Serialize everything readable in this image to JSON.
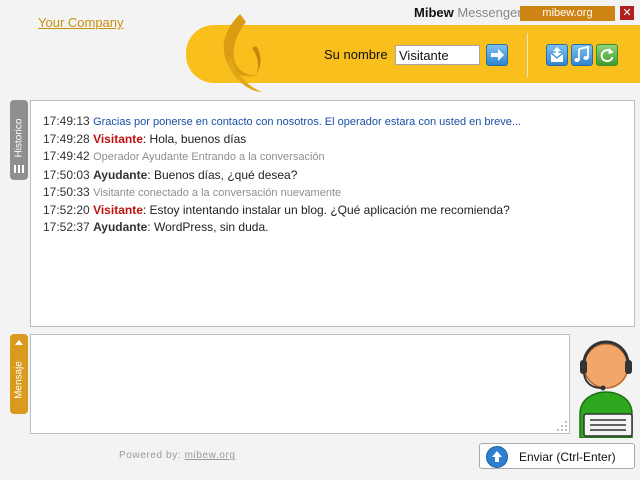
{
  "header": {
    "company_link": "Your Company",
    "brand_bold": "Mibew",
    "brand_light": "Messenger",
    "site_badge": "mibew.org",
    "name_label": "Su nombre",
    "name_value": "Visitante"
  },
  "side_tabs": {
    "history": "Historico",
    "message": "Mensaje"
  },
  "chat": {
    "messages": [
      {
        "time": "17:49:13",
        "kind": "info",
        "text": "Gracias por ponerse en contacto con nosotros. El operador estara con usted en breve..."
      },
      {
        "time": "17:49:28",
        "kind": "visitor",
        "who": "Visitante",
        "text": ": Hola, buenos días"
      },
      {
        "time": "17:49:42",
        "kind": "system",
        "text": "Operador Ayudante Entrando a la conversación"
      },
      {
        "time": "17:50:03",
        "kind": "operator",
        "who": "Ayudante",
        "text": ": Buenos días, ¿qué desea?"
      },
      {
        "time": "17:50:33",
        "kind": "system",
        "text": "Visitante conectado a la conversación nuevamente"
      },
      {
        "time": "17:52:20",
        "kind": "visitor",
        "who": "Visitante",
        "text": ": Estoy intentando instalar un blog. ¿Qué aplicación me recomienda?"
      },
      {
        "time": "17:52:37",
        "kind": "operator",
        "who": "Ayudante",
        "text": ": WordPress, sin duda."
      }
    ]
  },
  "footer": {
    "powered_by": "Powered by:",
    "powered_link": "mibew.org",
    "send_label": "Enviar (Ctrl-Enter)"
  },
  "colors": {
    "accent_yellow": "#f9bf1c",
    "badge_orange": "#cd8412",
    "visitor_red": "#c01010",
    "info_blue": "#1a4fa6"
  },
  "icons": {
    "submit_name": "arrow-right-icon",
    "mail_history": "mail-history-icon",
    "sound": "sound-icon",
    "refresh": "refresh-icon",
    "close": "close-icon",
    "send": "arrow-up-icon",
    "avatar": "operator-headset-avatar"
  }
}
